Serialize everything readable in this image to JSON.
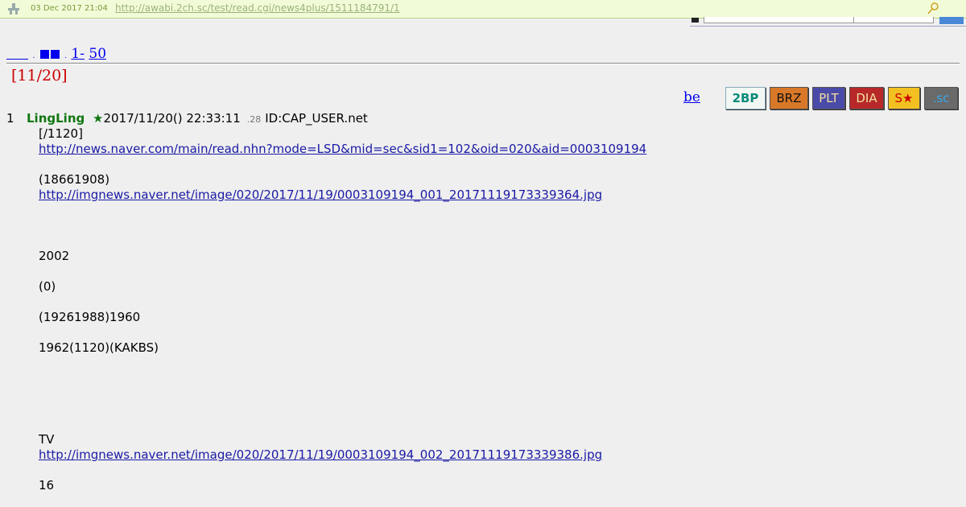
{
  "archive_bar": {
    "date": "03 Dec 2017 21:04",
    "url": "http://awabi.2ch.sc/test/read.cgi/news4plus/1511184791/1",
    "logo_icon": "archive-logo-icon",
    "pin_icon": "pin-icon"
  },
  "pager": {
    "range_start": "1-",
    "range_end": "50"
  },
  "thread": {
    "title": "[11/20]"
  },
  "toolbar": {
    "be": "be",
    "buttons": [
      "2BP",
      "BRZ",
      "PLT",
      "DIA",
      "S★",
      ".sc"
    ]
  },
  "post": {
    "number": "1",
    "name": "LingLing",
    "star": "★",
    "date": "2017/11/20() 22:33:11",
    "small": ".28",
    "id": "ID:CAP_USER.net",
    "lines": [
      "[/1120]",
      "http://news.naver.com/main/read.nhn?mode=LSD&mid=sec&sid1=102&oid=020&aid=0003109194",
      "(18661908)",
      "http://imgnews.naver.net/image/020/2017/11/19/0003109194_001_20171119173339364.jpg",
      "2002",
      "(0)",
      "(19261988)1960",
      "1962(1120)(KAKBS)",
      "TV",
      "http://imgnews.naver.net/image/020/2017/11/19/0003109194_002_20171119173339386.jpg",
      "16"
    ]
  }
}
